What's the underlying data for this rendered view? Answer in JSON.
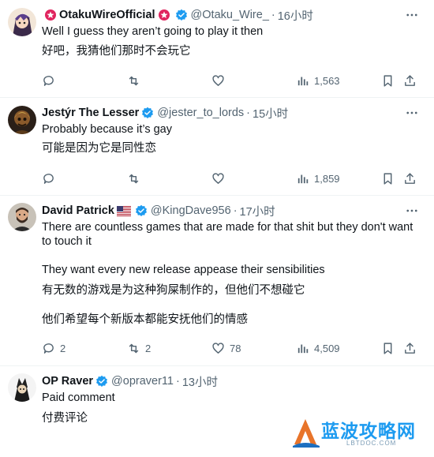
{
  "tweets": [
    {
      "name": "OtakuWireOfficial",
      "handle": "@Otaku_Wire_",
      "dot": "·",
      "time": "16小时",
      "lines": [
        "Well I guess they aren’t going to play it then",
        "好吧，我猜他们那时不会玩它"
      ],
      "actions": {
        "replies": "",
        "retweets": "",
        "likes": "",
        "views": "1,563"
      }
    },
    {
      "name": "Jestýr The Lesser",
      "handle": "@jester_to_lords",
      "dot": "·",
      "time": "15小时",
      "lines": [
        "Probably because it’s gay",
        "可能是因为它是同性恋"
      ],
      "actions": {
        "replies": "",
        "retweets": "",
        "likes": "",
        "views": "1,859"
      }
    },
    {
      "name": "David Patrick",
      "handle": "@KingDave956",
      "dot": "·",
      "time": "17小时",
      "lines": [
        "There are countless games that are made for that shit but they don't want",
        "to touch it",
        "They want every new release appease their sensibilities",
        "有无数的游戏是为这种狗屎制作的，但他们不想碰它",
        "他们希望每个新版本都能安抚他们的情感"
      ],
      "actions": {
        "replies": "2",
        "retweets": "2",
        "likes": "78",
        "views": "4,509"
      }
    },
    {
      "name": "OP Raver",
      "handle": "@opraver11",
      "dot": "·",
      "time": "13小时",
      "lines": [
        "Paid comment",
        "付费评论"
      ]
    }
  ],
  "watermark": {
    "text": "蓝波攻略网",
    "url": "LBTDOC.COM"
  },
  "colors": {
    "verified": "#1d9bf0",
    "muted": "#536471",
    "text": "#0f1419",
    "border": "#eff3f4"
  },
  "icons": [
    "reply-icon",
    "retweet-icon",
    "like-icon",
    "views-icon",
    "bookmark-icon",
    "share-icon",
    "more-icon",
    "verified-icon"
  ]
}
